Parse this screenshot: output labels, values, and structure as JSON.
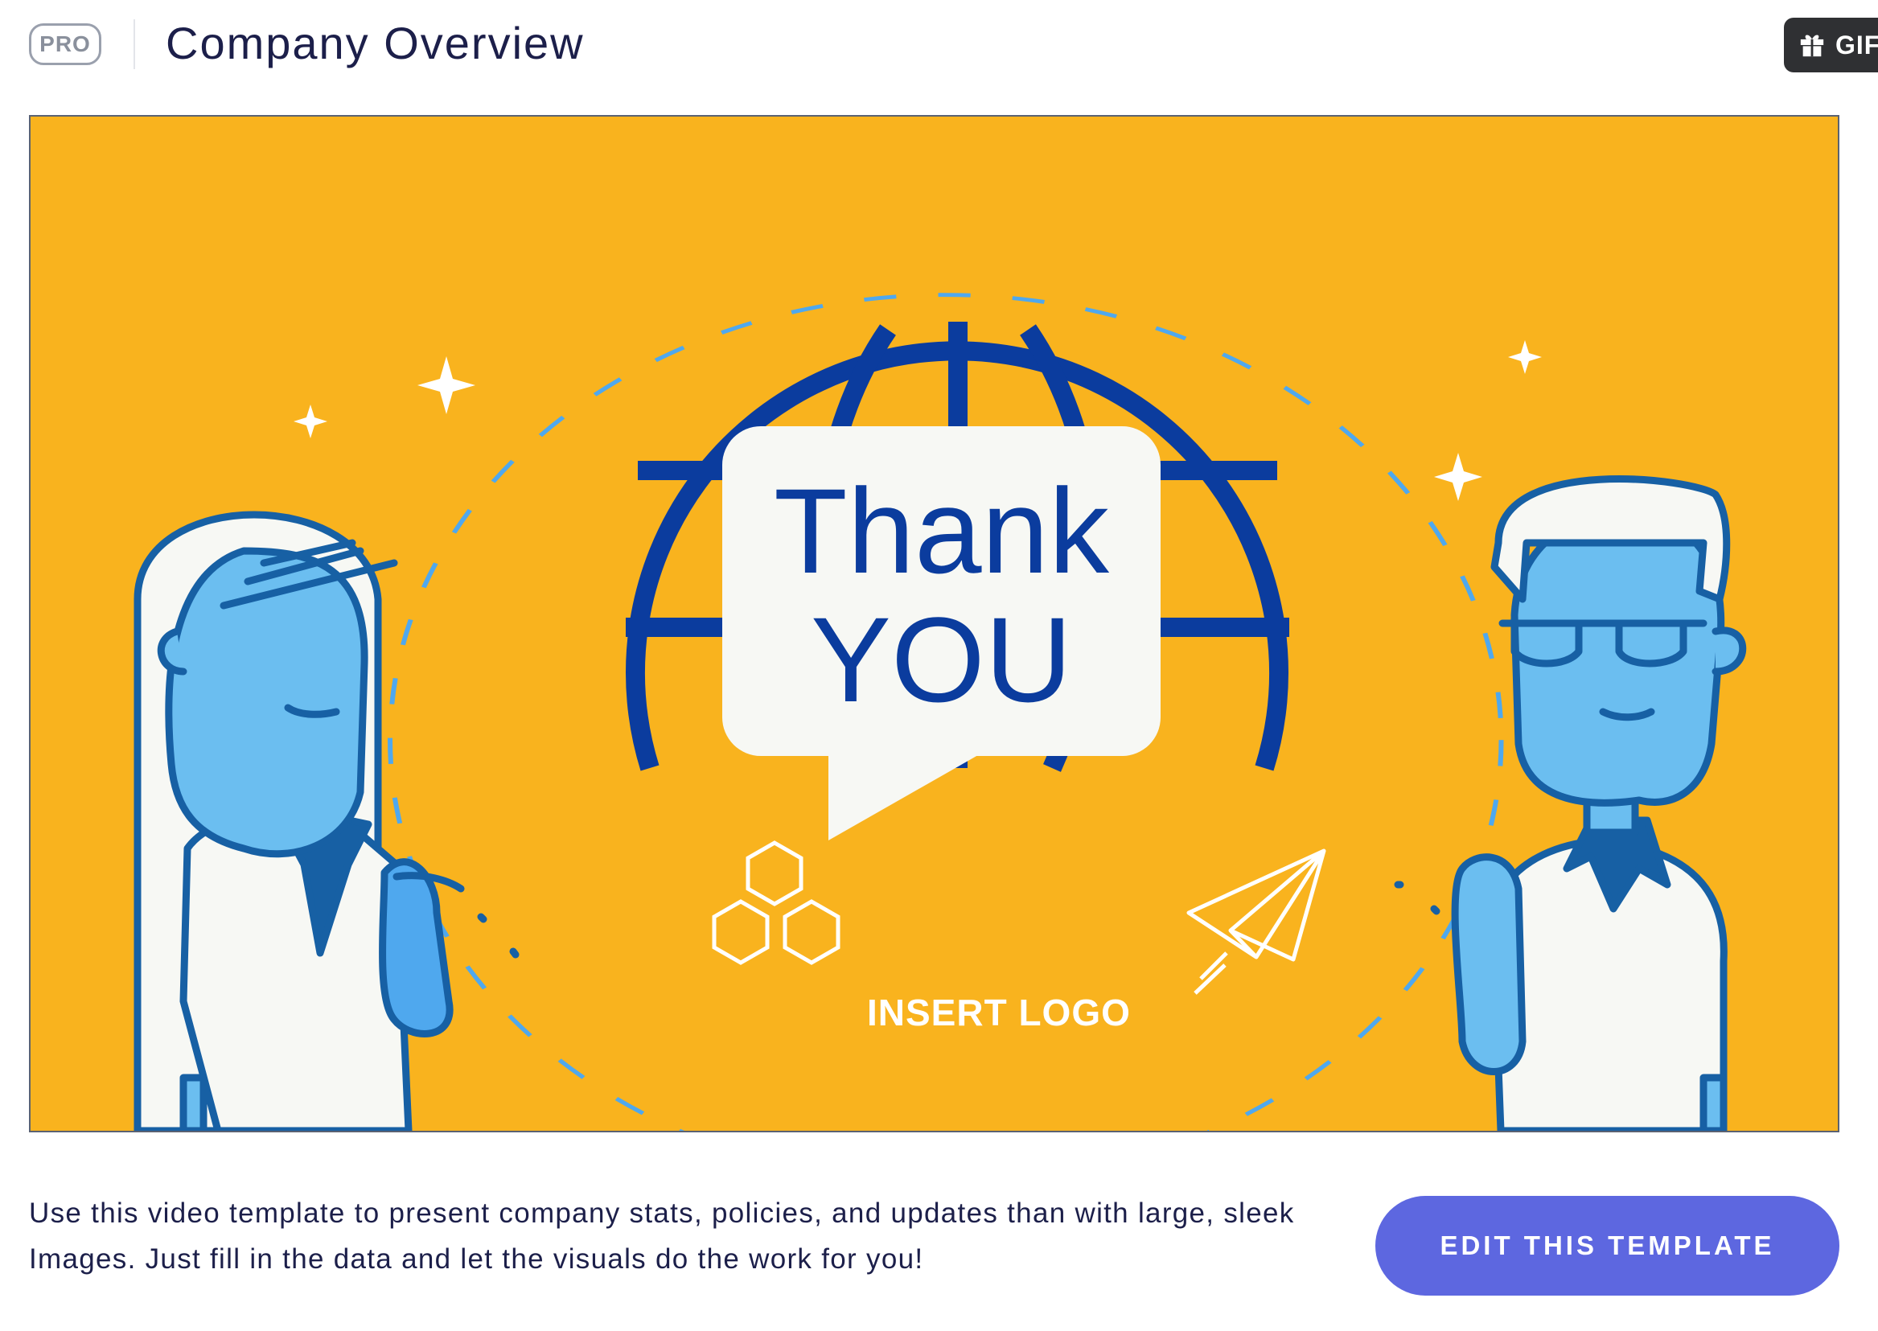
{
  "header": {
    "badge": "PRO",
    "title": "Company Overview",
    "gift_label": "GIF"
  },
  "preview": {
    "headline_line1": "Thank",
    "headline_line2": "YOU",
    "logo_text": "INSERT LOGO"
  },
  "description": "Use this video template to present company stats, policies, and updates than with large, sleek Images. Just fill in the data and let the visuals do the work for you!",
  "cta": {
    "label": "EDIT THIS TEMPLATE"
  },
  "colors": {
    "background": "#f9b31e",
    "navy": "#0b3c9e",
    "skin": "#6bbef0",
    "outline": "#1760a4",
    "button": "#5d67e0"
  }
}
